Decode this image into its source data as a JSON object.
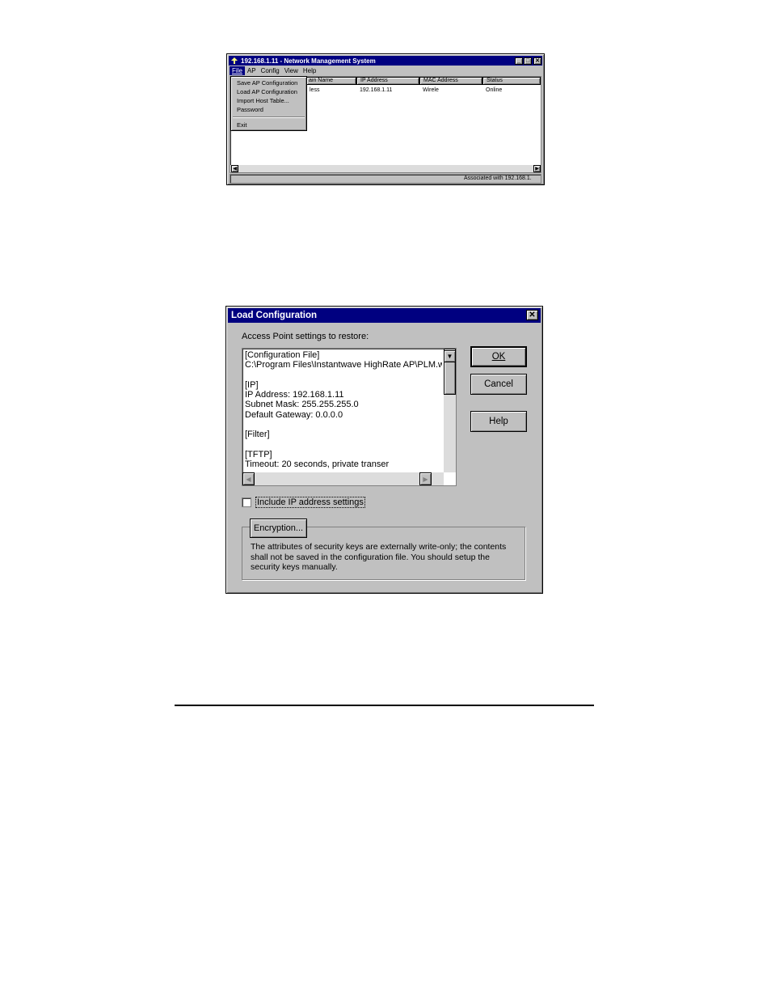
{
  "nms_window": {
    "title": "192.168.1.11 - Network Management System",
    "menu": [
      "File",
      "AP",
      "Config",
      "View",
      "Help"
    ],
    "file_menu": {
      "items": [
        "Save AP Configuration",
        "Load AP Configuration",
        "Import  Host Table...",
        "Password"
      ],
      "exit": "Exit"
    },
    "columns": [
      "ain Name",
      "IP Address",
      "MAC Address",
      "Status"
    ],
    "row": [
      "less",
      "192.168.1.11",
      "Wirele",
      "Online"
    ],
    "statusbar": "Associated with 192.168.1."
  },
  "load_dialog": {
    "title": "Load Configuration",
    "settings_label": "Access Point settings to restore:",
    "config_lines": [
      "[Configuration File]",
      "C:\\Program Files\\Instantwave HighRate AP\\PLM.wln",
      "",
      "[IP]",
      "IP Address: 192.168.1.11",
      "Subnet Mask: 255.255.255.0",
      "Default Gateway: 0.0.0.0",
      "",
      "[Filter]",
      "",
      "[TFTP]",
      "Timeout: 20 seconds, private transer"
    ],
    "ok_label": "OK",
    "cancel_label": "Cancel",
    "help_label": "Help",
    "include_ip_label": "Include IP address settings",
    "include_ip_checked": false,
    "encryption_label": "Encryption...",
    "security_note": "The attributes of security keys are externally write-only; the contents shall not be saved in the configuration file. You should setup the security keys manually."
  },
  "colors": {
    "titlebar": "#000080",
    "face": "#c0c0c0"
  }
}
